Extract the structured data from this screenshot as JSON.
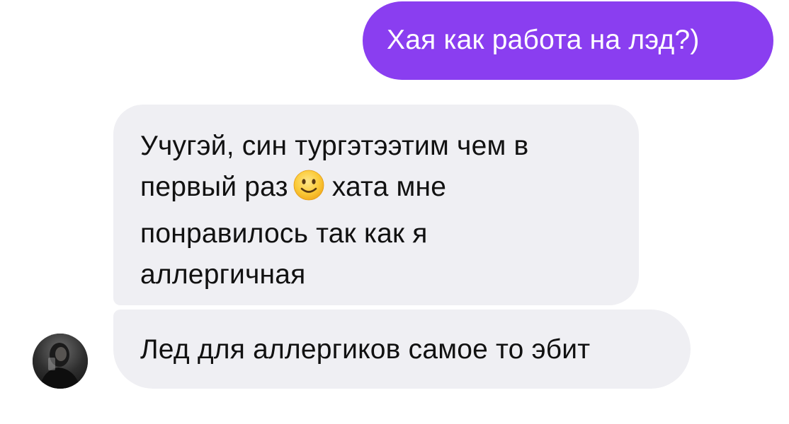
{
  "messages": {
    "outgoing": {
      "text": "Хая как работа на лэд?)"
    },
    "incoming_first": {
      "line1": "Учугэй, син тургэтээтим чем в",
      "line2_before": "первый раз",
      "line2_emoji": "slightly-smiling-face",
      "line2_after": "хата мне",
      "line3": "понравилось так как я",
      "line4": "аллергичная"
    },
    "incoming_second": {
      "text": "Лед для аллергиков самое то эбит"
    }
  },
  "sender": {
    "avatar_icon": "profile-photo"
  },
  "colors": {
    "outgoing_bubble": "#8a3ef0",
    "incoming_bubble": "#efeff3",
    "background": "#ffffff"
  }
}
